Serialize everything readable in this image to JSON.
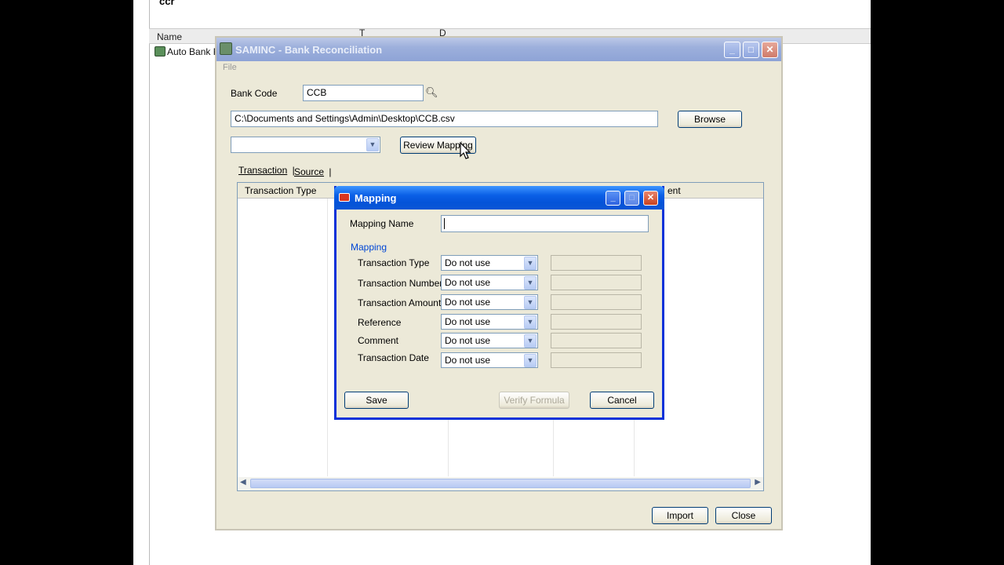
{
  "background": {
    "top_text": "ccr",
    "columns": [
      "Name",
      "T",
      "D"
    ],
    "items": [
      "Auto Bank R"
    ]
  },
  "window": {
    "title": "SAMINC - Bank Reconciliation",
    "menu": [
      "File"
    ],
    "bank_code_label": "Bank Code",
    "bank_code_value": "CCB",
    "file_path": "C:\\Documents and Settings\\Admin\\Desktop\\CCB.csv",
    "browse_label": "Browse",
    "mapping_select_value": "",
    "review_mapping_label": "Review Mapping",
    "tabs": [
      {
        "label": "Transaction",
        "active": true
      },
      {
        "label": "Source",
        "active": false
      }
    ],
    "grid_columns": [
      "Transaction Type",
      "ent"
    ],
    "import_label": "Import",
    "close_label": "Close"
  },
  "dialog": {
    "title": "Mapping",
    "mapping_name_label": "Mapping Name",
    "mapping_name_value": "",
    "group_label": "Mapping",
    "fields": [
      {
        "label": "Transaction Type",
        "value": "Do not use"
      },
      {
        "label": "Transaction Number",
        "value": "Do not use"
      },
      {
        "label": "Transaction Amount",
        "value": "Do not use"
      },
      {
        "label": "Reference",
        "value": "Do not use"
      },
      {
        "label": "Comment",
        "value": "Do not use"
      },
      {
        "label": "Transaction Date",
        "value": "Do not use"
      }
    ],
    "save_label": "Save",
    "verify_label": "Verify Formula",
    "cancel_label": "Cancel"
  },
  "colors": {
    "active_title": "#0a5fe6",
    "inactive_title": "#9db0dc",
    "window_face": "#ece9d8",
    "group_label": "#0046d5"
  }
}
